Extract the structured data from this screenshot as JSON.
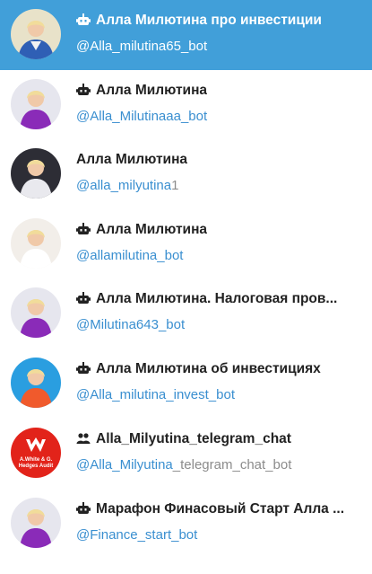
{
  "colors": {
    "active_bg": "#419fd9",
    "link": "#3a8fd0",
    "muted": "#8c8c8c",
    "text": "#222222"
  },
  "results": [
    {
      "title": "Алла Милютина про инвестиции",
      "is_bot": true,
      "handle_match": "@Alla_milutina65_bot",
      "handle_rest": "",
      "avatar": "woman-blonde-blue-blazer",
      "active": true
    },
    {
      "title": "Алла Милютина",
      "is_bot": true,
      "handle_match": "@Alla_Milutinaaa_bot",
      "handle_rest": "",
      "avatar": "woman-blonde-purple",
      "active": false
    },
    {
      "title": "Алла Милютина",
      "is_bot": false,
      "handle_match": "@alla_milyutina",
      "handle_rest": "1",
      "avatar": "woman-blonde-dark-bg",
      "active": false
    },
    {
      "title": "Алла Милютина",
      "is_bot": true,
      "handle_match": "@allamilutina_bot",
      "handle_rest": "",
      "avatar": "woman-blonde-white",
      "active": false
    },
    {
      "title": "Алла Милютина. Налоговая пров...",
      "is_bot": true,
      "handle_match": "@Milutina643_bot",
      "handle_rest": "",
      "avatar": "woman-blonde-purple",
      "active": false
    },
    {
      "title": "Алла Милютина об инвестициях",
      "is_bot": true,
      "handle_match": "@Alla_milutina_invest_bot",
      "handle_rest": "",
      "avatar": "woman-blonde-orange-blue-bg",
      "active": false
    },
    {
      "title": "Alla_Milyutina_telegram_chat",
      "is_bot": false,
      "is_group": true,
      "handle_match": "@Alla_Milyutina",
      "handle_rest": "_telegram_chat_bot",
      "avatar": "logo-awhite-hedges-audit",
      "avatar_text_1": "A.White & G.",
      "avatar_text_2": "Hedges Audit",
      "active": false
    },
    {
      "title": "Марафон Финасовый Старт Алла ...",
      "is_bot": true,
      "handle_match": "@Finance_start_bot",
      "handle_rest": "",
      "avatar": "woman-blonde-purple",
      "active": false
    }
  ]
}
